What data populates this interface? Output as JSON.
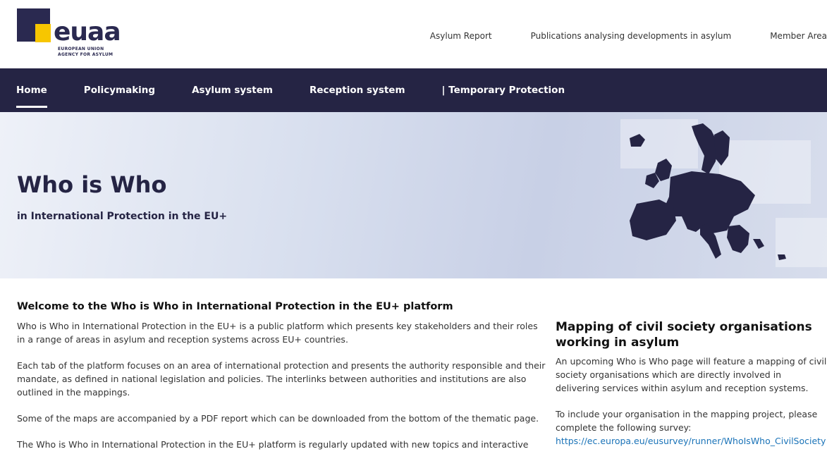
{
  "logo": {
    "wordmark": "euaa",
    "line1": "EUROPEAN UNION",
    "line2": "AGENCY FOR ASYLUM"
  },
  "top_links": [
    "Asylum Report",
    "Publications analysing developments in asylum",
    "Member Area"
  ],
  "nav": {
    "items": [
      "Home",
      "Policymaking",
      "Asylum system",
      "Reception system",
      "| Temporary Protection"
    ],
    "active": "Home"
  },
  "hero": {
    "title": "Who is Who",
    "subtitle": "in International Protection in the EU+"
  },
  "welcome": {
    "heading": "Welcome to the Who is Who in International Protection in the EU+ platform",
    "paragraphs": [
      "Who is Who in International Protection in the EU+ is a public platform which presents key stakeholders and their roles in a range of areas in asylum and reception systems across EU+ countries.",
      "Each tab of the platform focuses on an area of international protection and presents the authority responsible and their mandate, as defined in national legislation and policies. The interlinks between authorities and institutions are also outlined in the mappings.",
      "Some of the maps are accompanied by a PDF report which can be downloaded from the bottom of the thematic page.",
      "The Who is Who in International Protection in the EU+ platform is regularly updated with new topics and interactive"
    ]
  },
  "sidebar": {
    "heading": "Mapping of civil society organisations working in asylum",
    "paragraph1": "An upcoming Who is Who page will feature a mapping of civil society organisations which are directly involved in delivering services within asylum and reception systems.",
    "paragraph2": "To include your organisation in the mapping project, please complete the following survey:",
    "link": "https://ec.europa.eu/eusurvey/runner/WhoIsWho_CivilSociety"
  },
  "colors": {
    "navy": "#252444",
    "logo_yellow": "#f7c600",
    "link": "#1a73b8"
  }
}
